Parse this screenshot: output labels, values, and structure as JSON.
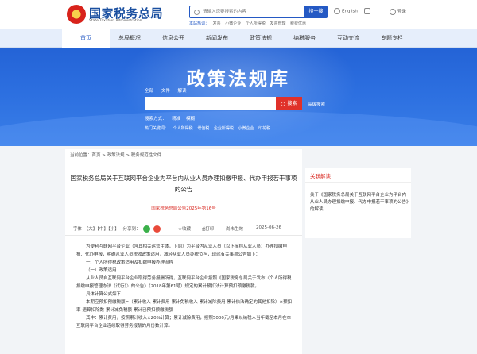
{
  "header": {
    "logo_cn": "国家税务总局",
    "logo_en": "State Taxation Administration",
    "search_placeholder": "请输入您要搜索的内容",
    "search_button": "搜一搜",
    "hot_label": "本站热词：",
    "hot_words": [
      "发票",
      "小微企业",
      "个人所得税",
      "发票管理",
      "税费优惠"
    ],
    "lang": "English",
    "tool2": "",
    "login": "登录"
  },
  "nav": {
    "items": [
      "首页",
      "总局概况",
      "信息公开",
      "新闻发布",
      "政策法规",
      "纳税服务",
      "互动交流",
      "专题专栏"
    ],
    "active_index": 0
  },
  "banner": {
    "title": "政策法规库",
    "scope": [
      "全部",
      "文件",
      "解读"
    ],
    "search_button": "搜索",
    "advanced": "高级搜索",
    "mode_label": "搜索方式：",
    "modes": [
      "精准",
      "模糊"
    ],
    "hot_label": "热门关键词：",
    "hot_words": [
      "个人所得税",
      "增值税",
      "企业所得税",
      "小微企业",
      "印花税"
    ]
  },
  "breadcrumb": "当前位置：首页 > 政策法规 > 税务规范性文件",
  "doc": {
    "title_line1": "国家税务总局关于互联网平台企业为平台内从业人员办理扣缴申报、代办申报若干事项",
    "title_line2": "的公告",
    "number": "国家税务总局公告2025年第16号",
    "font_label": "字体：【大】【中】【小】",
    "share_label": "分享到：",
    "favorite": "收藏",
    "print": "打印",
    "source": "尚未生效",
    "date": "2025-06-26",
    "paragraphs": [
      "为便利互联网平台企业（含其相关运营主体，下同）为平台内从业人员（以下简称从业人员）办理扣缴申报、代办申报，明确从业人员税收政策适用，减轻从业人员办税负担，现就有关事项公告如下：",
      "一、个人所得税政策适用及扣缴申报办理流程",
      "（一）政策适用",
      "从业人员自互联网平台企业取得劳务报酬所得，互联网平台企业按照《国家税务总局关于发布〈个人所得税扣缴申报管理办法（试行）〉的公告》（2018年第61号）规定的累计预扣法计算预扣预缴税款。",
      "具体计算公式如下：",
      "本期应预扣预缴税额=（累计收入-累计费用-累计免税收入-累计减除费用-累计依法确定的其他扣除）×预扣率-速算扣除数-累计减免税额-累计已预扣预缴税额",
      "其中：累计费用，按照累计收入×20%计算；累计减除费用，按照5000元/月乘以纳税人当年截至本月在本互联网平台企业连续取得劳务报酬的月份数计算。"
    ]
  },
  "sidebar": {
    "title": "关联解读",
    "text": "关于《国家税务总局关于互联网平台企业为平台内从业人员办理扣缴申报、代办申报若干事项的公告》的解读"
  },
  "colors": {
    "brand_blue": "#2459c4",
    "red": "#d8231b",
    "banner_blue": "#2c6fe0",
    "wechat_green": "#3bb04a",
    "weibo_red": "#e94a3a"
  }
}
